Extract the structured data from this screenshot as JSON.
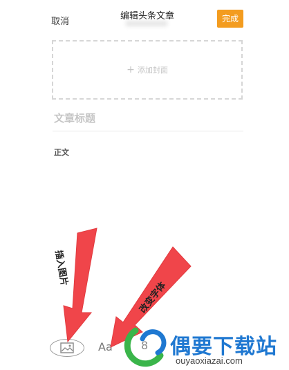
{
  "header": {
    "cancel_label": "取消",
    "title": "编辑头条文章",
    "done_label": "完成"
  },
  "cover": {
    "add_cover_label": "添加封面"
  },
  "editor": {
    "title_placeholder": "文章标题",
    "body_placeholder": "正文"
  },
  "toolbar": {
    "font_label": "Aa",
    "link_label": "8"
  },
  "annotations": {
    "insert_image": "插入图片",
    "change_font": "改变字体"
  },
  "watermark": {
    "site_name": "偶要下载站",
    "site_url": "ouyaoxiazai.com"
  },
  "colors": {
    "done_button": "#f39c1f",
    "arrow": "#f0454a",
    "watermark_text": "#1f78d1"
  }
}
